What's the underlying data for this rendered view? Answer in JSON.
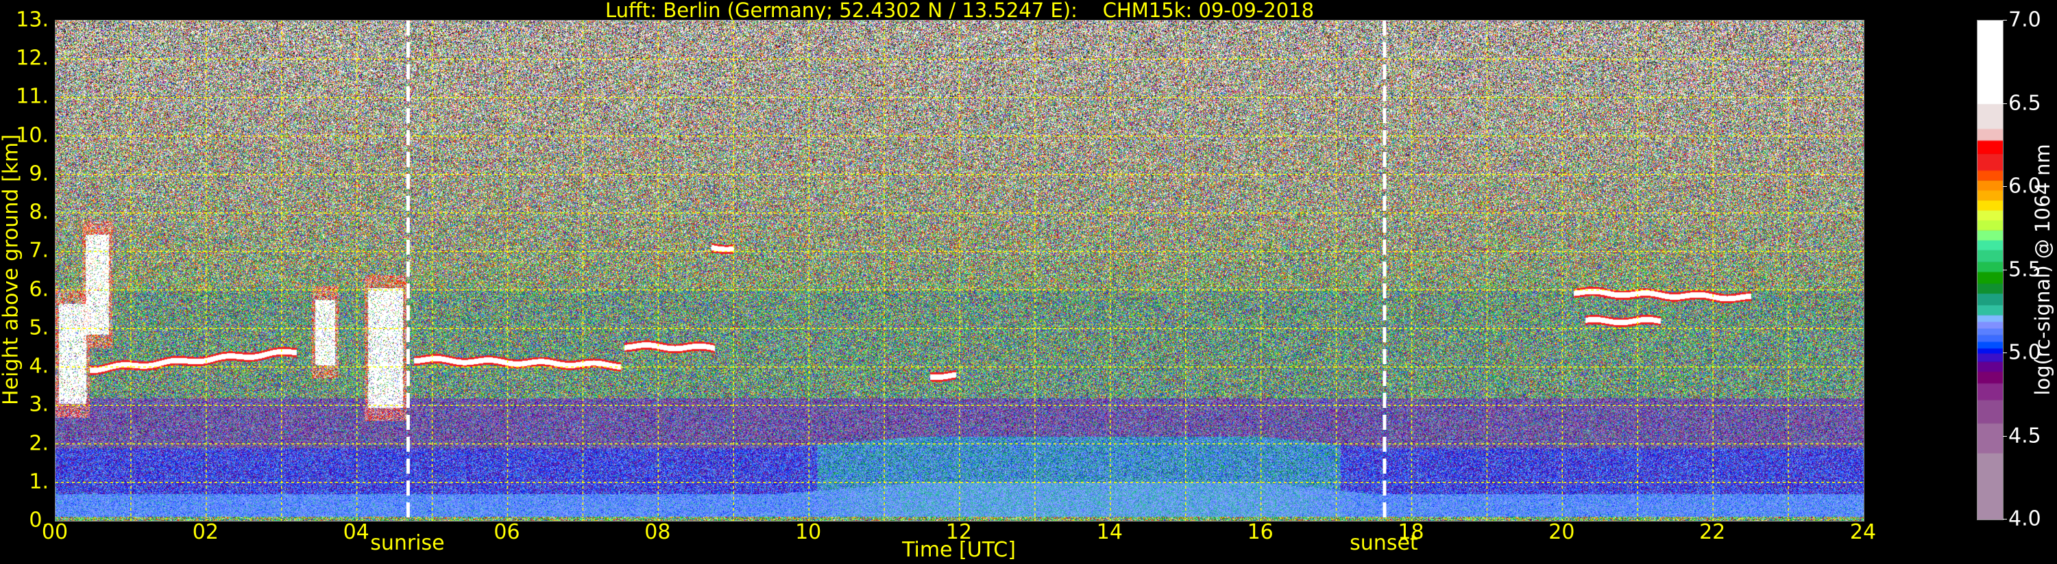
{
  "chart_data": {
    "type": "heatmap",
    "title": "Lufft: Berlin (Germany; 52.4302 N / 13.5247 E):    CHM15k: 09-09-2018",
    "xlabel": "Time [UTC]",
    "ylabel": "Height above ground [km]",
    "xlim": [
      0,
      24
    ],
    "ylim": [
      0,
      13
    ],
    "grid": true,
    "grid_color": "#ffff00",
    "xticks": [
      {
        "value": 0,
        "label": "00"
      },
      {
        "value": 2,
        "label": "02"
      },
      {
        "value": 4,
        "label": "04"
      },
      {
        "value": 6,
        "label": "06"
      },
      {
        "value": 8,
        "label": "08"
      },
      {
        "value": 10,
        "label": "10"
      },
      {
        "value": 12,
        "label": "12"
      },
      {
        "value": 14,
        "label": "14"
      },
      {
        "value": 16,
        "label": "16"
      },
      {
        "value": 18,
        "label": "18"
      },
      {
        "value": 20,
        "label": "20"
      },
      {
        "value": 22,
        "label": "22"
      },
      {
        "value": 24,
        "label": "24"
      }
    ],
    "yticks": [
      {
        "value": 0,
        "label": "0."
      },
      {
        "value": 1,
        "label": "1."
      },
      {
        "value": 2,
        "label": "2."
      },
      {
        "value": 3,
        "label": "3."
      },
      {
        "value": 4,
        "label": "4."
      },
      {
        "value": 5,
        "label": "5."
      },
      {
        "value": 6,
        "label": "6."
      },
      {
        "value": 7,
        "label": "7."
      },
      {
        "value": 8,
        "label": "8."
      },
      {
        "value": 9,
        "label": "9."
      },
      {
        "value": 10,
        "label": "10."
      },
      {
        "value": 11,
        "label": "11."
      },
      {
        "value": 12,
        "label": "12."
      },
      {
        "value": 13,
        "label": "13."
      }
    ],
    "annotations": [
      {
        "label": "sunrise",
        "time": 4.68
      },
      {
        "label": "sunset",
        "time": 17.64
      }
    ],
    "cloud_layers": [
      {
        "start": 0.45,
        "end": 3.2,
        "height_start": 3.95,
        "height_end": 4.4
      },
      {
        "start": 4.75,
        "end": 7.5,
        "height_start": 4.2,
        "height_end": 4.05
      },
      {
        "start": 7.55,
        "end": 8.75,
        "height_start": 4.55,
        "height_end": 4.5
      },
      {
        "start": 8.7,
        "end": 9.0,
        "height_start": 7.1,
        "height_end": 7.1
      },
      {
        "start": 11.6,
        "end": 11.95,
        "height_start": 3.78,
        "height_end": 3.78
      },
      {
        "start": 20.15,
        "end": 22.5,
        "height_start": 5.95,
        "height_end": 5.8
      },
      {
        "start": 20.3,
        "end": 21.3,
        "height_start": 5.2,
        "height_end": 5.2
      }
    ],
    "cloud_columns": [
      {
        "start": 0.0,
        "end": 0.45,
        "bottom": 2.7,
        "top": 6.0
      },
      {
        "start": 0.35,
        "end": 0.75,
        "bottom": 4.5,
        "top": 7.8
      },
      {
        "start": 3.4,
        "end": 3.75,
        "bottom": 3.7,
        "top": 6.1
      },
      {
        "start": 4.1,
        "end": 4.65,
        "bottom": 2.6,
        "top": 6.4
      }
    ],
    "colorbar": {
      "label": "log(rc-signal) @ 1064 nm",
      "range": [
        4.0,
        7.0
      ],
      "ticks": [
        {
          "value": 4.0,
          "label": "4.0"
        },
        {
          "value": 4.5,
          "label": "4.5"
        },
        {
          "value": 5.0,
          "label": "5.0"
        },
        {
          "value": 5.5,
          "label": "5.5"
        },
        {
          "value": 6.0,
          "label": "6.0"
        },
        {
          "value": 6.5,
          "label": "6.5"
        },
        {
          "value": 7.0,
          "label": "7.0"
        }
      ],
      "levels": [
        {
          "min": 4.0,
          "color": "#a98ba8"
        },
        {
          "min": 4.4,
          "color": "#9e6c9e"
        },
        {
          "min": 4.58,
          "color": "#8f4c92"
        },
        {
          "min": 4.72,
          "color": "#882a8a"
        },
        {
          "min": 4.82,
          "color": "#7a0070"
        },
        {
          "min": 4.89,
          "color": "#640090"
        },
        {
          "min": 4.95,
          "color": "#3a10c8"
        },
        {
          "min": 5.0,
          "color": "#0010f0"
        },
        {
          "min": 5.03,
          "color": "#0050ff"
        },
        {
          "min": 5.07,
          "color": "#3c6cff"
        },
        {
          "min": 5.11,
          "color": "#5a80ff"
        },
        {
          "min": 5.15,
          "color": "#8090ff"
        },
        {
          "min": 5.19,
          "color": "#80b8ff"
        },
        {
          "min": 5.23,
          "color": "#30c0a0"
        },
        {
          "min": 5.29,
          "color": "#1ca080"
        },
        {
          "min": 5.36,
          "color": "#109030"
        },
        {
          "min": 5.42,
          "color": "#10a000"
        },
        {
          "min": 5.49,
          "color": "#20c050"
        },
        {
          "min": 5.55,
          "color": "#30d080"
        },
        {
          "min": 5.62,
          "color": "#40e8a0"
        },
        {
          "min": 5.68,
          "color": "#80ff80"
        },
        {
          "min": 5.74,
          "color": "#c0ff40"
        },
        {
          "min": 5.8,
          "color": "#e0ff40"
        },
        {
          "min": 5.86,
          "color": "#ffe000"
        },
        {
          "min": 5.92,
          "color": "#ffb000"
        },
        {
          "min": 5.98,
          "color": "#ff9000"
        },
        {
          "min": 6.04,
          "color": "#ff5000"
        },
        {
          "min": 6.1,
          "color": "#f02020"
        },
        {
          "min": 6.2,
          "color": "#ff0000"
        },
        {
          "min": 6.28,
          "color": "#f0c0c0"
        },
        {
          "min": 6.35,
          "color": "#ece0e0"
        },
        {
          "min": 6.5,
          "color": "#ffffff"
        }
      ],
      "below_range_color": "#000000"
    }
  }
}
